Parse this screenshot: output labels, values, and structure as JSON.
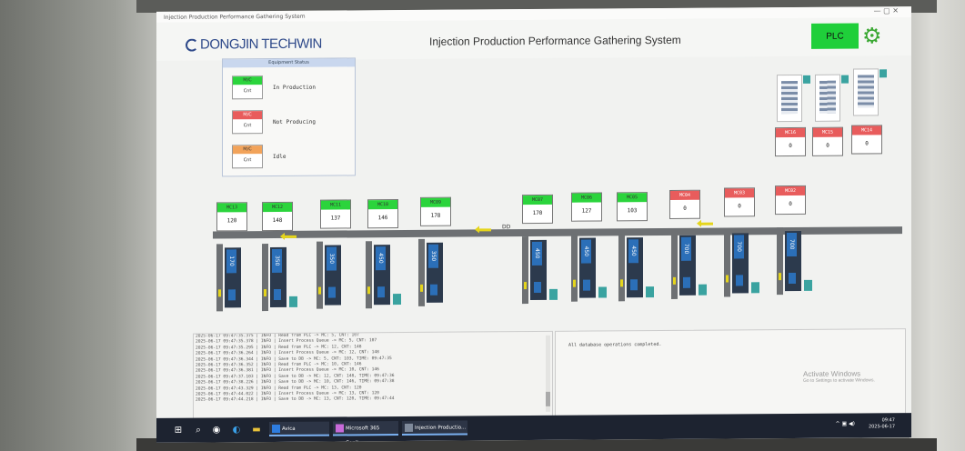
{
  "window": {
    "title": "Injection Production Performance Gathering System",
    "controls": "— ▢ ✕"
  },
  "header": {
    "logo": "DONGJIN TECHWIN",
    "title": "Injection Production Performance Gathering System",
    "plc_label": "PLC"
  },
  "colors": {
    "green": "#2bd43c",
    "red": "#e85c5c",
    "orange": "#f2a35a",
    "plc": "#1fcf3a"
  },
  "legend": {
    "title": "Equipment Status",
    "items": [
      {
        "box_top": "M/C",
        "box_bottom": "Cnt",
        "label": "In Production"
      },
      {
        "box_top": "M/C",
        "box_bottom": "Cnt",
        "label": "Not Producing"
      },
      {
        "box_top": "M/C",
        "box_bottom": "Cnt",
        "label": "Idle"
      }
    ]
  },
  "top_machines": [
    {
      "name": "MC16",
      "count": "0"
    },
    {
      "name": "MC15",
      "count": "0"
    },
    {
      "name": "MC14",
      "count": "0"
    }
  ],
  "machines": [
    {
      "name": "MC13",
      "count": "120"
    },
    {
      "name": "MC12",
      "count": "148"
    },
    {
      "name": "MC11",
      "count": "137"
    },
    {
      "name": "MC10",
      "count": "146"
    },
    {
      "name": "MC09",
      "count": "178"
    },
    {
      "name": "MC07",
      "count": "170"
    },
    {
      "name": "MC06",
      "count": "127"
    },
    {
      "name": "MC05",
      "count": "103"
    },
    {
      "name": "MC04",
      "count": "0"
    },
    {
      "name": "MC03",
      "count": "0"
    },
    {
      "name": "MC02",
      "count": "0"
    }
  ],
  "conveyor_label": "DD",
  "press_tonnage": [
    "170",
    "350",
    "350",
    "450",
    "350",
    "450",
    "450",
    "450",
    "700",
    "700",
    "700"
  ],
  "log": [
    "2025-06-17 09:47:35.375 | INFO | Read from PLC -> MC: 5, CNT: 107",
    "2025-06-17 09:47:35.378 | INFO | Insert Process Queue -> MC: 5, CNT: 107",
    "2025-06-17 09:47:35.295 | INFO | Read from PLC -> MC: 12, CNT: 148",
    "2025-06-17 09:47:36.264 | INFO | Insert Process Queue -> MC: 12, CNT: 148",
    "2025-06-17 09:47:36.344 | INFO | Save to DB -> MC: 5, CNT: 103, TIME: 09:47:35",
    "2025-06-17 09:47:36.352 | INFO | Read from PLC -> MC: 10, CNT: 146",
    "2025-06-17 09:47:36.381 | INFO | Insert Process Queue -> MC: 10, CNT: 146",
    "2025-06-17 09:47:37.103 | INFO | Save to DB -> MC: 12, CNT: 148, TIME: 09:47:36",
    "2025-06-17 09:47:38.226 | INFO | Save to DB -> MC: 10, CNT: 146, TIME: 09:47:38",
    "2025-06-17 09:47:43.329 | INFO | Read from PLC -> MC: 13, CNT: 120",
    "2025-06-17 09:47:44.022 | INFO | Insert Process Queue -> MC: 13, CNT: 120",
    "2025-06-17 09:47:44.218 | INFO | Save to DB -> MC: 13, CNT: 120, TIME: 09:47:44"
  ],
  "db_message": "All database operations completed.",
  "watermark": {
    "line1": "Activate Windows",
    "line2": "Go to Settings to activate Windows."
  },
  "taskbar": {
    "apps": [
      {
        "label": "Avica"
      },
      {
        "label": "Microsoft 365 Copil..."
      },
      {
        "label": "Injection Productio..."
      }
    ],
    "time": "09:47",
    "date": "2025-06-17"
  }
}
